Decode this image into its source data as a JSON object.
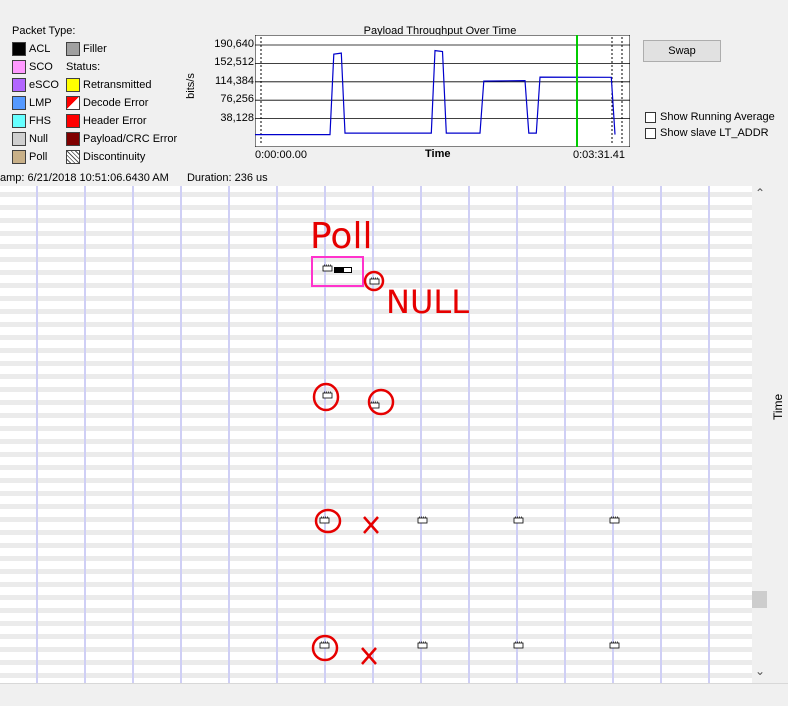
{
  "legend": {
    "title": "Packet Type:",
    "types": [
      {
        "label": "ACL",
        "color": "#000000"
      },
      {
        "label": "SCO",
        "color": "#ff99ff"
      },
      {
        "label": "eSCO",
        "color": "#b266ff"
      },
      {
        "label": "LMP",
        "color": "#5599ff"
      },
      {
        "label": "FHS",
        "color": "#66ffff"
      },
      {
        "label": "Null",
        "color": "#cfcfcf"
      },
      {
        "label": "Poll",
        "color": "#c8b088"
      }
    ],
    "filler": {
      "label": "Filler",
      "color": "#a0a0a0"
    },
    "status_title": "Status:",
    "statuses": [
      {
        "label": "Retransmitted",
        "color": "#ffff00"
      },
      {
        "label": "Decode Error",
        "color": "#ff0000",
        "icon": "diagonal-split-icon"
      },
      {
        "label": "Header Error",
        "color": "#ff0000"
      },
      {
        "label": "Payload/CRC Error",
        "color": "#800000"
      },
      {
        "label": "Discontinuity",
        "icon": "crosshatch-icon"
      }
    ]
  },
  "chart": {
    "title": "Payload Throughput Over Time",
    "y_label": "bits/s",
    "x_label": "Time",
    "x_start": "0:00:00.00",
    "x_end": "0:03:31.41",
    "y_ticks": [
      "190,640",
      "152,512",
      "114,384",
      "76,256",
      "38,128"
    ],
    "line_color": "#0000cc",
    "cursor_color": "#00cc00"
  },
  "chart_data": {
    "type": "line",
    "title": "Payload Throughput Over Time",
    "xlabel": "Time",
    "ylabel": "bits/s",
    "x_range": [
      "0:00:00.00",
      "0:03:31.41"
    ],
    "ylim": [
      0,
      190640
    ],
    "y_ticks": [
      190640,
      152512,
      114384,
      76256,
      38128
    ],
    "series": [
      {
        "x": [
          0.0,
          0.02,
          0.2,
          0.21,
          0.23,
          0.24,
          0.47,
          0.48,
          0.5,
          0.51,
          0.6,
          0.61,
          0.72,
          0.73,
          0.75,
          0.76,
          0.95,
          0.96
        ],
        "y": [
          5000,
          5000,
          5000,
          175000,
          175000,
          8000,
          8000,
          175000,
          175000,
          8000,
          8000,
          120000,
          120000,
          8000,
          8000,
          120000,
          120000,
          5000
        ]
      }
    ]
  },
  "controls": {
    "swap_label": "Swap",
    "show_running_average": "Show Running Average",
    "show_slave_lt_addr": "Show slave LT_ADDR"
  },
  "info": {
    "timestamp": "amp: 6/21/2018 10:51:06.6430 AM",
    "duration": "Duration: 236 us"
  },
  "timeline": {
    "axis_label": "Time",
    "annotation_color": "#e60000",
    "highlight_color": "#ff33cc",
    "annotations": [
      "Poll",
      "NULL"
    ]
  }
}
